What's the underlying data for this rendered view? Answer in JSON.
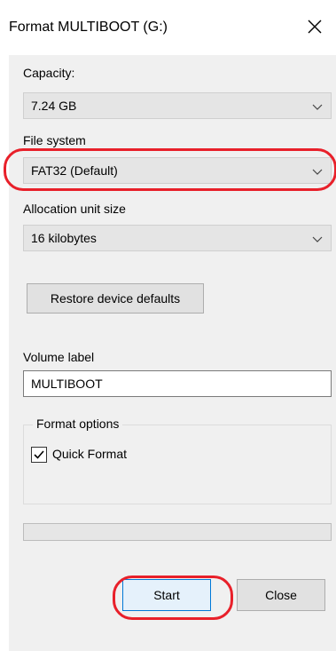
{
  "window": {
    "title": "Format MULTIBOOT (G:)"
  },
  "capacity": {
    "label": "Capacity:",
    "value": "7.24 GB"
  },
  "file_system": {
    "label": "File system",
    "value": "FAT32 (Default)"
  },
  "allocation": {
    "label": "Allocation unit size",
    "value": "16 kilobytes"
  },
  "restore_button": "Restore device defaults",
  "volume_label": {
    "label": "Volume label",
    "value": "MULTIBOOT"
  },
  "format_options": {
    "title": "Format options",
    "quick_format_label": "Quick Format",
    "quick_format_checked": true
  },
  "progress": {
    "value": 0
  },
  "buttons": {
    "start": "Start",
    "close": "Close"
  },
  "colors": {
    "annotation_red": "#e8202a",
    "dialog_bg": "#f0f0f0",
    "start_button_bg": "#e5f1fb",
    "start_button_border": "#0078d7"
  }
}
